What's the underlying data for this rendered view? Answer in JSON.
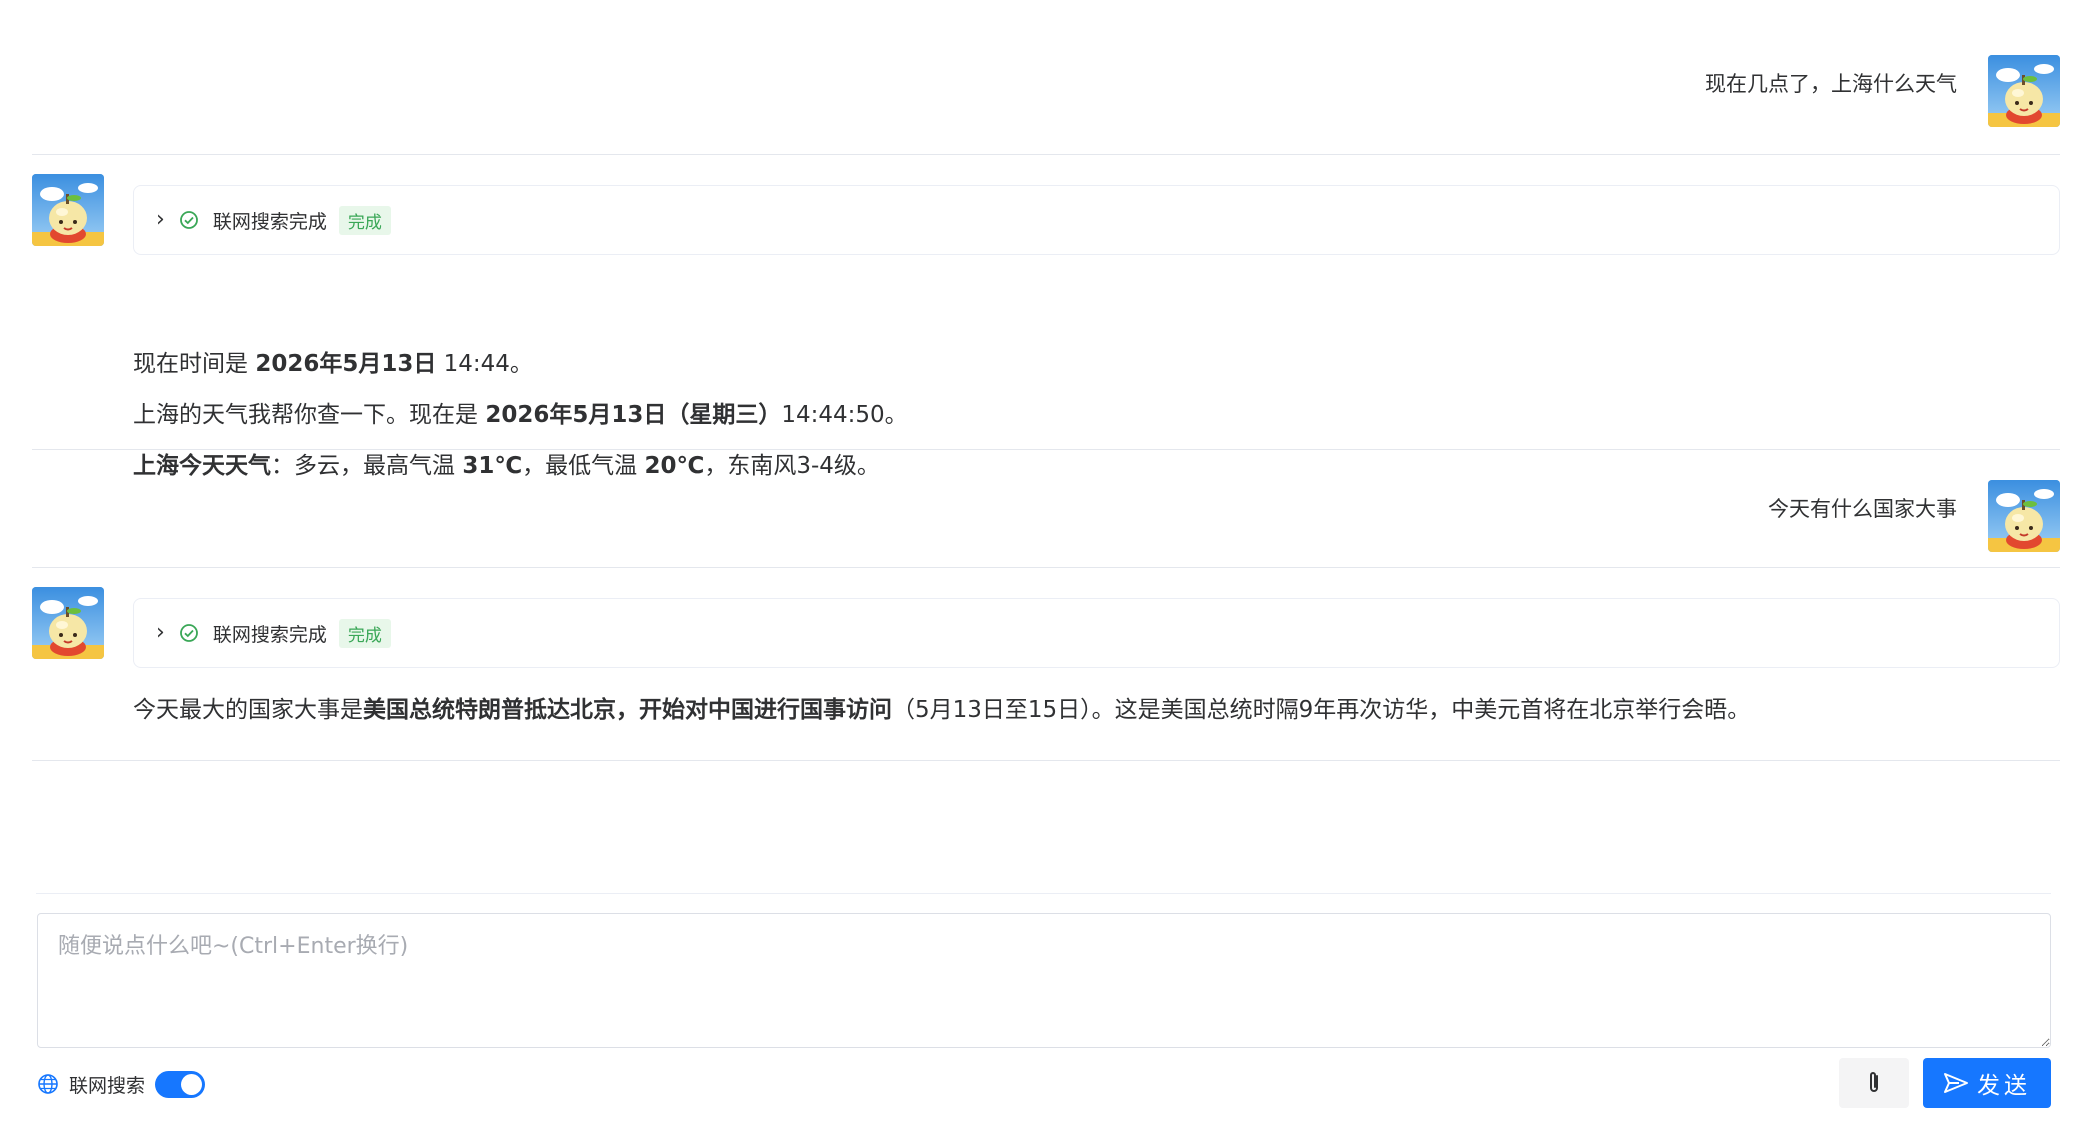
{
  "messages": [
    {
      "role": "user",
      "text": "现在几点了，上海什么天气"
    },
    {
      "role": "assistant",
      "search_status": "联网搜索完成",
      "search_tag": "完成",
      "lines": {
        "l1_pre": "现在时间是 ",
        "l1_b": "2026年5月13日",
        "l1_post": " 14:44。",
        "l2_pre": "上海的天气我帮你查一下。现在是 ",
        "l2_b": "2026年5月13日（星期三）",
        "l2_post": "14:44:50。",
        "l3_b1": "上海今天天气",
        "l3_m1": "：多云，最高气温 ",
        "l3_b2": "31℃",
        "l3_m2": "，最低气温 ",
        "l3_b3": "20℃",
        "l3_m3": "，东南风3-4级。"
      }
    },
    {
      "role": "user",
      "text": "今天有什么国家大事"
    },
    {
      "role": "assistant",
      "search_status": "联网搜索完成",
      "search_tag": "完成",
      "lines": {
        "l1_pre": "今天最大的国家大事是",
        "l1_b": "美国总统特朗普抵达北京，开始对中国进行国事访问",
        "l1_post": "（5月13日至15日）。这是美国总统时隔9年再次访华，中美元首将在北京举行会晤。"
      }
    }
  ],
  "composer": {
    "placeholder": "随便说点什么吧~(Ctrl+Enter换行)",
    "web_search_label": "联网搜索",
    "web_search_enabled": true,
    "send_label": "发送"
  },
  "icons": {
    "avatar": "apple-avatar-icon",
    "expand": "chevron-right-icon",
    "status": "check-circle-icon",
    "globe": "globe-icon",
    "attach": "paperclip-icon",
    "send": "send-icon"
  },
  "colors": {
    "accent": "#1677ff",
    "success": "#3aa757",
    "divider": "#e4e7ed"
  }
}
